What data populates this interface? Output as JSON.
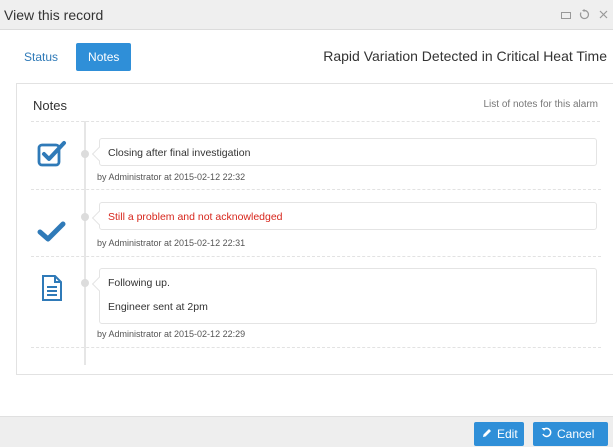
{
  "window": {
    "title": "View this record",
    "controls": [
      "minimize-icon",
      "refresh-icon",
      "close-icon"
    ]
  },
  "tabs": [
    {
      "label": "Status",
      "active": false
    },
    {
      "label": "Notes",
      "active": true
    }
  ],
  "record_heading": "Rapid Variation Detected in Critical Heat Time",
  "notes_panel": {
    "title": "Notes",
    "description": "List of notes for this alarm",
    "entries": [
      {
        "icon": "checkbox-checked-icon",
        "lines": [
          "Closing after final investigation"
        ],
        "meta": "by Administrator at 2015-02-12 22:32"
      },
      {
        "icon": "checkmark-icon",
        "lines": [
          "Still a problem and not acknowledged"
        ],
        "meta": "by Administrator at 2015-02-12 22:31",
        "text_color": "#d7261c"
      },
      {
        "icon": "document-icon",
        "lines": [
          "Following up.",
          "Engineer sent at 2pm"
        ],
        "meta": "by Administrator at 2015-02-12 22:29"
      }
    ]
  },
  "footer": {
    "edit_label": "Edit",
    "cancel_label": "Cancel"
  },
  "colors": {
    "accent": "#2f8fd8",
    "warning_text": "#d7261c"
  }
}
